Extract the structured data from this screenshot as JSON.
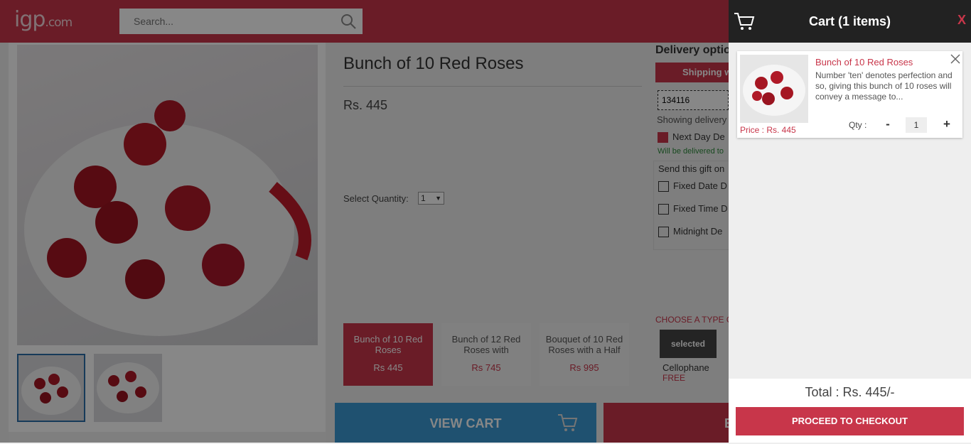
{
  "header": {
    "logo_text": "igp",
    "logo_suffix": ".com",
    "search_placeholder": "Search..."
  },
  "product": {
    "title": "Bunch of 10 Red Roses",
    "price": "Rs. 445",
    "quantity_label": "Select Quantity:",
    "quantity_value": "1"
  },
  "variants": [
    {
      "name": "Bunch of 10 Red Roses",
      "price": "Rs 445",
      "selected": true
    },
    {
      "name": "Bunch of 12 Red Roses with",
      "price": "Rs 745",
      "selected": false
    },
    {
      "name": "Bouquet of 10 Red Roses with a Half",
      "price": "Rs 995",
      "selected": false
    }
  ],
  "delivery": {
    "title": "Delivery optio",
    "shipping_label": "Shipping w",
    "pincode": "134116",
    "showing": "Showing delivery",
    "next_day": "Next Day De",
    "will_be": "Will be delivered to",
    "send_title": "Send this gift on",
    "options": [
      "Fixed Date D",
      "Fixed Time D",
      "Midnight De"
    ]
  },
  "packaging": {
    "title": "CHOOSE A TYPE O",
    "badge": "selected",
    "name": "Cellophane",
    "price": "FREE"
  },
  "actions": {
    "view_cart": "VIEW CART",
    "buy_now": "B"
  },
  "cart": {
    "title": "Cart (1 items)",
    "close": "X",
    "item": {
      "name": "Bunch of 10 Red Roses",
      "description": "Number 'ten' denotes perfection and so, giving this bunch of 10 roses will convey a message to...",
      "price": "Price : Rs. 445",
      "qty_label": "Qty :",
      "qty_minus": "-",
      "qty_value": "1",
      "qty_plus": "+"
    },
    "total": "Total : Rs. 445/-",
    "checkout": "PROCEED TO CHECKOUT"
  },
  "colors": {
    "brand": "#c8364a",
    "cart_header": "#222222",
    "view_cart": "#3b9ad3"
  }
}
